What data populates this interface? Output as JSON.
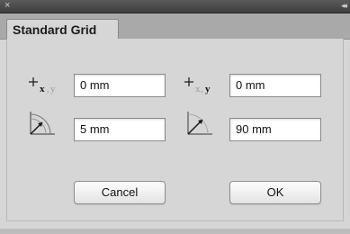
{
  "window": {
    "close_glyph": "×",
    "collapse_glyph": "◂◂"
  },
  "tab": {
    "label": "Standard Grid"
  },
  "fields": {
    "x_origin": {
      "value": "0 mm",
      "icon": "x-origin-icon"
    },
    "y_origin": {
      "value": "0 mm",
      "icon": "y-origin-icon"
    },
    "distance": {
      "value": "5 mm",
      "icon": "distance-angle-icon"
    },
    "angle": {
      "value": "90 mm",
      "icon": "angle-icon"
    }
  },
  "buttons": {
    "cancel": "Cancel",
    "ok": "OK"
  },
  "colors": {
    "panel_bg": "#d6d6d6",
    "titlebar_bg": "#4a4a4a",
    "tabstrip_bg": "#a9a9a9"
  }
}
